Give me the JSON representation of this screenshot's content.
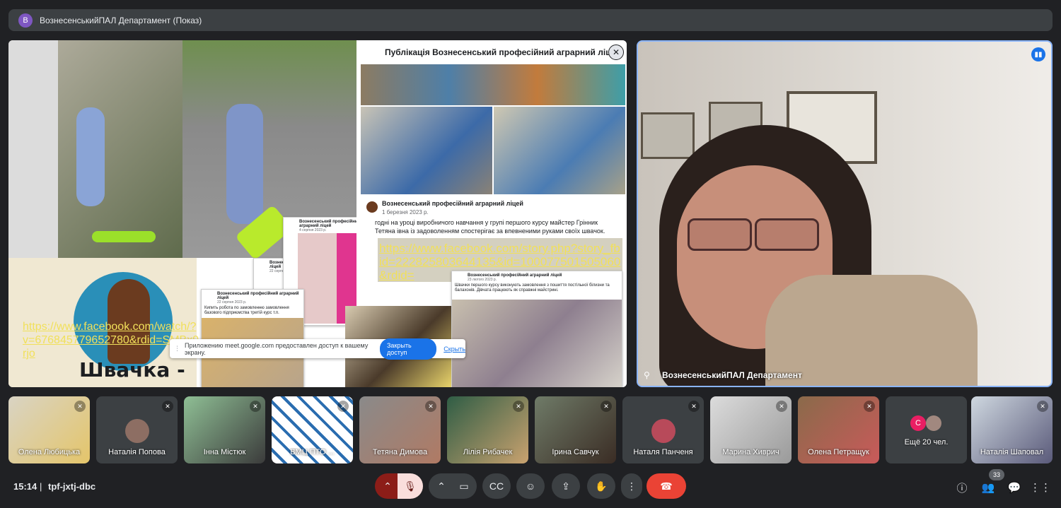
{
  "header": {
    "avatar_letter": "В",
    "title": "ВознесенськийПАЛ Департамент (Показ)"
  },
  "presentation": {
    "fb_post_title": "Публікація Вознесенський професійний аграрний ліцей",
    "close_symbol": "✕",
    "post_author": "Вознесенський професійний аграрний ліцей",
    "post_date": "1 березня 2023 р.",
    "post_text": "годні на уроці виробничого навчання у групі першого курсу майстер Грінник Тетяна івна із задоволенням спостерігає за впевненими руками своїх швачок.",
    "story_link": "https://www.facebook.com/story.php?story_fbid=222825803644135&id=100077501505060&rdid=",
    "left_link": "https://www.facebook.com/watch/?v=676845779652780&rdid=SMBx9rjo",
    "shvachka_label": "Швачка -",
    "card1_name": "Вознесенський професійний аграрний ліцей",
    "card1_date": "4 серпня 2023 р.",
    "card2_name": "Вознесенський професійний аграрний ліцей",
    "card2_date": "22 серпня 2023 р.",
    "card3_name": "Вознесенський професійний аграрний ліцей",
    "card3_date": "23 лютого 2023 р.",
    "card3_text": "Швачки першого курсу виконують замовлення з пошиття постільної білизни та балахонів. Дівчата працюють як справжні майстрині.",
    "card4_name": "Вознесенський професійний аграрний ліцей",
    "card4_date": "22 серпня 2023 р.",
    "card4_text": "Кипить робота по замовленню замовлення базового підприємства третій курс т.п.",
    "share_text": "Приложению meet.google.com предоставлен доступ к вашему экрану.",
    "share_stop": "Закрыть доступ",
    "share_hide": "Скрыть"
  },
  "speaker": {
    "name": "ВознесенськийПАЛ Департамент",
    "pin_icon": "pin-icon"
  },
  "participants": [
    {
      "name": "Олена Любицька"
    },
    {
      "name": "Наталія Попова"
    },
    {
      "name": "Інна Містюк"
    },
    {
      "name": "ВМЦ ПТО ..."
    },
    {
      "name": "Тетяна Димова"
    },
    {
      "name": "Лілія Рибачек"
    },
    {
      "name": "Ірина Савчук"
    },
    {
      "name": "Наталя Панченя"
    },
    {
      "name": "Марина Хиврич"
    },
    {
      "name": "Олена Петращук"
    },
    {
      "name": "Ещё 20 чел.",
      "avatar_letter": "С"
    },
    {
      "name": "Наталія Шаповал"
    }
  ],
  "bottombar": {
    "time": "15:14",
    "separator": "|",
    "meeting_code": "tpf-jxtj-dbc",
    "people_count": "33"
  },
  "colors": {
    "background": "#202124",
    "surface": "#3c4043",
    "accent_blue": "#8ab4f8",
    "end_call": "#ea4335"
  }
}
